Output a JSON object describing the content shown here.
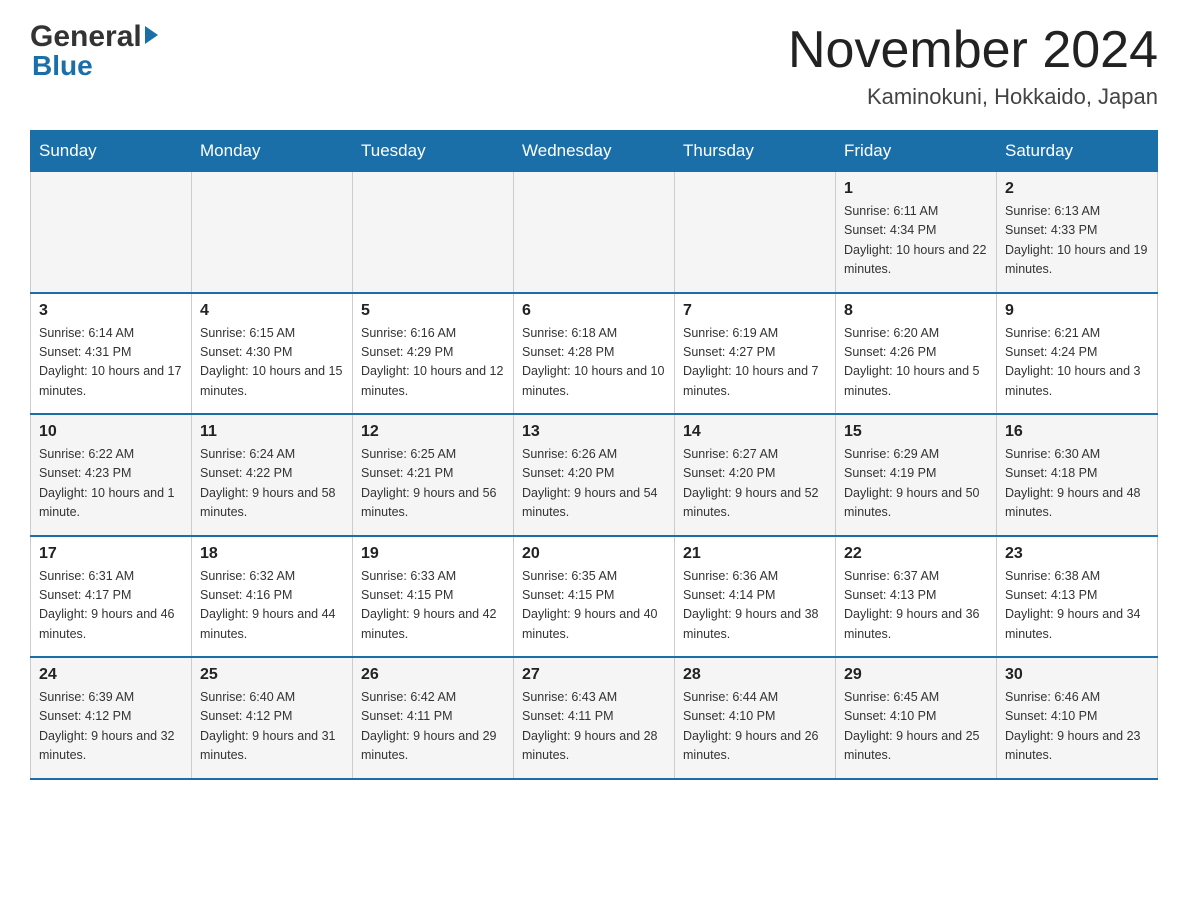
{
  "header": {
    "logo_general": "General",
    "logo_blue": "Blue",
    "month_title": "November 2024",
    "location": "Kaminokuni, Hokkaido, Japan"
  },
  "days_of_week": [
    "Sunday",
    "Monday",
    "Tuesday",
    "Wednesday",
    "Thursday",
    "Friday",
    "Saturday"
  ],
  "weeks": [
    [
      {
        "day": "",
        "info": ""
      },
      {
        "day": "",
        "info": ""
      },
      {
        "day": "",
        "info": ""
      },
      {
        "day": "",
        "info": ""
      },
      {
        "day": "",
        "info": ""
      },
      {
        "day": "1",
        "info": "Sunrise: 6:11 AM\nSunset: 4:34 PM\nDaylight: 10 hours and 22 minutes."
      },
      {
        "day": "2",
        "info": "Sunrise: 6:13 AM\nSunset: 4:33 PM\nDaylight: 10 hours and 19 minutes."
      }
    ],
    [
      {
        "day": "3",
        "info": "Sunrise: 6:14 AM\nSunset: 4:31 PM\nDaylight: 10 hours and 17 minutes."
      },
      {
        "day": "4",
        "info": "Sunrise: 6:15 AM\nSunset: 4:30 PM\nDaylight: 10 hours and 15 minutes."
      },
      {
        "day": "5",
        "info": "Sunrise: 6:16 AM\nSunset: 4:29 PM\nDaylight: 10 hours and 12 minutes."
      },
      {
        "day": "6",
        "info": "Sunrise: 6:18 AM\nSunset: 4:28 PM\nDaylight: 10 hours and 10 minutes."
      },
      {
        "day": "7",
        "info": "Sunrise: 6:19 AM\nSunset: 4:27 PM\nDaylight: 10 hours and 7 minutes."
      },
      {
        "day": "8",
        "info": "Sunrise: 6:20 AM\nSunset: 4:26 PM\nDaylight: 10 hours and 5 minutes."
      },
      {
        "day": "9",
        "info": "Sunrise: 6:21 AM\nSunset: 4:24 PM\nDaylight: 10 hours and 3 minutes."
      }
    ],
    [
      {
        "day": "10",
        "info": "Sunrise: 6:22 AM\nSunset: 4:23 PM\nDaylight: 10 hours and 1 minute."
      },
      {
        "day": "11",
        "info": "Sunrise: 6:24 AM\nSunset: 4:22 PM\nDaylight: 9 hours and 58 minutes."
      },
      {
        "day": "12",
        "info": "Sunrise: 6:25 AM\nSunset: 4:21 PM\nDaylight: 9 hours and 56 minutes."
      },
      {
        "day": "13",
        "info": "Sunrise: 6:26 AM\nSunset: 4:20 PM\nDaylight: 9 hours and 54 minutes."
      },
      {
        "day": "14",
        "info": "Sunrise: 6:27 AM\nSunset: 4:20 PM\nDaylight: 9 hours and 52 minutes."
      },
      {
        "day": "15",
        "info": "Sunrise: 6:29 AM\nSunset: 4:19 PM\nDaylight: 9 hours and 50 minutes."
      },
      {
        "day": "16",
        "info": "Sunrise: 6:30 AM\nSunset: 4:18 PM\nDaylight: 9 hours and 48 minutes."
      }
    ],
    [
      {
        "day": "17",
        "info": "Sunrise: 6:31 AM\nSunset: 4:17 PM\nDaylight: 9 hours and 46 minutes."
      },
      {
        "day": "18",
        "info": "Sunrise: 6:32 AM\nSunset: 4:16 PM\nDaylight: 9 hours and 44 minutes."
      },
      {
        "day": "19",
        "info": "Sunrise: 6:33 AM\nSunset: 4:15 PM\nDaylight: 9 hours and 42 minutes."
      },
      {
        "day": "20",
        "info": "Sunrise: 6:35 AM\nSunset: 4:15 PM\nDaylight: 9 hours and 40 minutes."
      },
      {
        "day": "21",
        "info": "Sunrise: 6:36 AM\nSunset: 4:14 PM\nDaylight: 9 hours and 38 minutes."
      },
      {
        "day": "22",
        "info": "Sunrise: 6:37 AM\nSunset: 4:13 PM\nDaylight: 9 hours and 36 minutes."
      },
      {
        "day": "23",
        "info": "Sunrise: 6:38 AM\nSunset: 4:13 PM\nDaylight: 9 hours and 34 minutes."
      }
    ],
    [
      {
        "day": "24",
        "info": "Sunrise: 6:39 AM\nSunset: 4:12 PM\nDaylight: 9 hours and 32 minutes."
      },
      {
        "day": "25",
        "info": "Sunrise: 6:40 AM\nSunset: 4:12 PM\nDaylight: 9 hours and 31 minutes."
      },
      {
        "day": "26",
        "info": "Sunrise: 6:42 AM\nSunset: 4:11 PM\nDaylight: 9 hours and 29 minutes."
      },
      {
        "day": "27",
        "info": "Sunrise: 6:43 AM\nSunset: 4:11 PM\nDaylight: 9 hours and 28 minutes."
      },
      {
        "day": "28",
        "info": "Sunrise: 6:44 AM\nSunset: 4:10 PM\nDaylight: 9 hours and 26 minutes."
      },
      {
        "day": "29",
        "info": "Sunrise: 6:45 AM\nSunset: 4:10 PM\nDaylight: 9 hours and 25 minutes."
      },
      {
        "day": "30",
        "info": "Sunrise: 6:46 AM\nSunset: 4:10 PM\nDaylight: 9 hours and 23 minutes."
      }
    ]
  ]
}
